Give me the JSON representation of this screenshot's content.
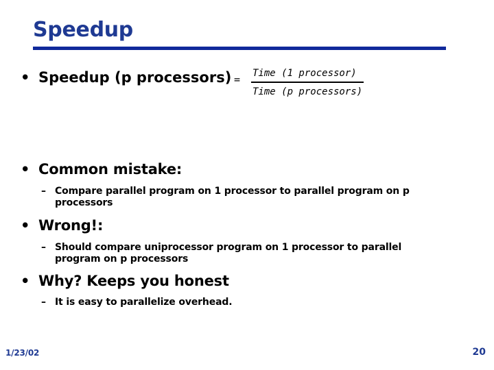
{
  "slide": {
    "title": "Speedup",
    "accent_color": "#10299B",
    "title_color": "#1F3A93",
    "background_color": "#ffffff",
    "body_text_color": "#000000"
  },
  "bullets": {
    "bullet_glyph": "•",
    "dash_glyph": "–"
  },
  "equation": {
    "lhs": "Speedup (p processors)",
    "equals": "=",
    "numerator": "Time (1 processor)",
    "denominator": "Time (p processors)"
  },
  "items": [
    {
      "level1": "Common mistake:",
      "level2": "Compare parallel program on 1 processor to parallel program on p processors"
    },
    {
      "level1": "Wrong!:",
      "level2": "Should compare uniprocessor program on 1 processor to parallel program on p processors"
    },
    {
      "level1": "Why? Keeps you honest",
      "level2": "It is easy to parallelize overhead."
    }
  ],
  "footer": {
    "date": "1/23/02",
    "page_number": "20"
  }
}
